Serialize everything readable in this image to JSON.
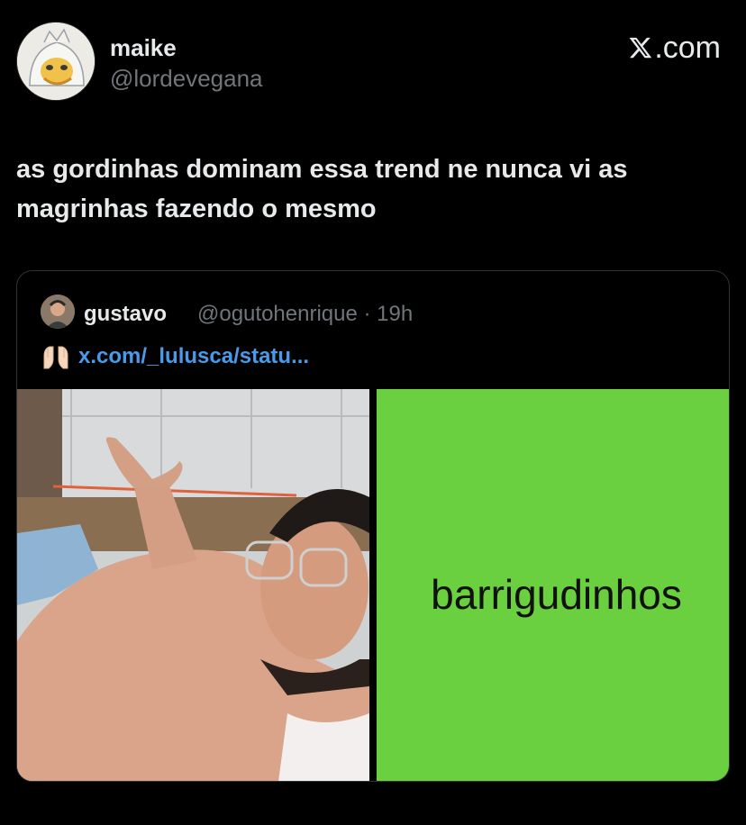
{
  "post": {
    "author_name": "maike",
    "author_handle": "@lordevegana",
    "brand_suffix": ".com",
    "text": "as gordinhas dominam essa trend ne nunca vi as magrinhas fazendo o mesmo"
  },
  "quoted": {
    "author_name": "gustavo",
    "meta": "@ogutohenrique · 19h",
    "link_text": "x.com/_lulusca/statu...",
    "emoji": "raised-hands-icon",
    "image_text": "barrigudinhos"
  },
  "colors": {
    "background": "#000000",
    "text": "#e7e9ea",
    "muted": "#71767b",
    "link": "#4a9aea",
    "green_panel": "#6ad03f"
  }
}
